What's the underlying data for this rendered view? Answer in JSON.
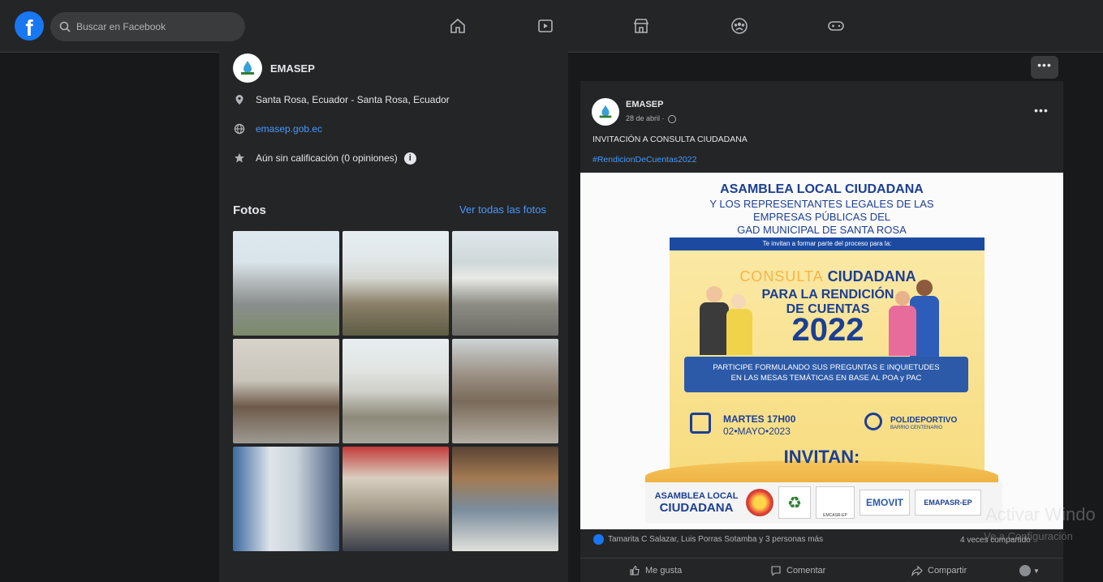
{
  "search": {
    "placeholder": "Buscar en Facebook"
  },
  "page": {
    "name": "EMASEP",
    "location": "Santa Rosa, Ecuador - Santa Rosa, Ecuador",
    "website": "emasep.gob.ec",
    "rating": "Aún sin calificación (0 opiniones)"
  },
  "photos": {
    "title": "Fotos",
    "see_all": "Ver todas las fotos"
  },
  "post": {
    "author": "EMASEP",
    "date": "28 de abril ·",
    "text": "INVITACIÓN A CONSULTA CIUDADANA",
    "hashtag": "#RendicionDeCuentas2022",
    "reactions": "Tamarita C Salazar, Luis Porras Sotamba y 3 personas más",
    "shares": "4 veces compartido",
    "actions": {
      "like": "Me gusta",
      "comment": "Comentar",
      "share": "Compartir"
    }
  },
  "poster": {
    "title": "ASAMBLEA LOCAL CIUDADANA",
    "subtitle_1": "Y LOS REPRESENTANTES LEGALES DE LAS",
    "subtitle_2": "EMPRESAS PÚBLICAS DEL",
    "subtitle_3": "GAD MUNICIPAL DE SANTA ROSA",
    "invite_bar": "Te invitan a formar parte del proceso para la:",
    "consulta": "CONSULTA",
    "ciudadana": "CIUDADANA",
    "rendicion_1": "PARA LA RENDICIÓN",
    "rendicion_2": "DE CUENTAS",
    "year": "2022",
    "participe_1": "PARTICIPE FORMULANDO SUS PREGUNTAS E INQUIETUDES",
    "participe_2": "EN LAS MESAS TEMÁTICAS EN BASE AL POA y PAC",
    "day_time": "MARTES 17H00",
    "date": "02•MAYO•2023",
    "place_1": "POLIDEPORTIVO",
    "place_2": "BARRIO CENTENARIO",
    "invitan": "INVITAN:",
    "logo_1": "ASAMBLEA LOCAL",
    "logo_2": "CIUDADANA",
    "logo_3": "EMCASR-EP",
    "logo_4": "EMOVIT",
    "logo_5": "EMAPASR-EP"
  },
  "watermark": {
    "line1": "Activar Windo",
    "line2": "Ve a Configuración"
  },
  "colors": {
    "accent": "#1877f2",
    "link": "#4599ff",
    "bg": "#18191a",
    "card": "#242526"
  }
}
